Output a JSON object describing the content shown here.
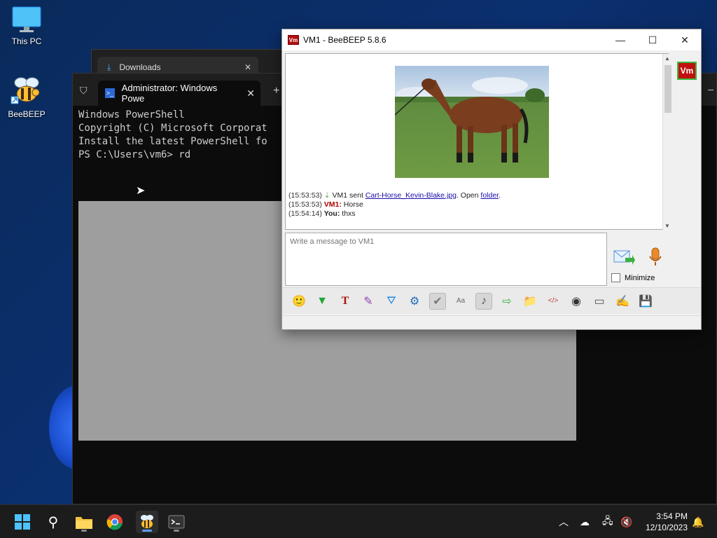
{
  "desktop": {
    "icons": [
      {
        "label": "This PC",
        "icon": "monitor-icon"
      },
      {
        "label": "BeeBEEP",
        "icon": "bee-icon"
      }
    ]
  },
  "downloads_window": {
    "tab_label": "Downloads"
  },
  "powershell": {
    "tab_title": "Administrator: Windows Powe",
    "lines": [
      "Windows PowerShell",
      "Copyright (C) Microsoft Corporat",
      "",
      "Install the latest PowerShell fo",
      "",
      "PS C:\\Users\\vm6> rd"
    ]
  },
  "beebeep": {
    "title": "VM1 - BeeBEEP 5.8.6",
    "app_icon_text": "Vm",
    "side_badge": "Vm",
    "messages": [
      {
        "time": "(15:53:53)",
        "prefix": "VM1 sent ",
        "link": "Cart-Horse_Kevin-Blake.jpg",
        "mid": ". Open ",
        "link2": "folder",
        "suffix": "."
      },
      {
        "time": "(15:53:53)",
        "sender": "VM1:",
        "text": " Horse"
      },
      {
        "time": "(15:54:14)",
        "sender": "You:",
        "text": " thxs"
      }
    ],
    "input_placeholder": "Write a message to VM1",
    "minimize_label": "Minimize",
    "colors": {
      "vm_red": "#b00000",
      "link_blue": "#1a0dab",
      "badge_border": "#3bb83b"
    }
  },
  "taskbar": {
    "time": "3:54 PM",
    "date": "12/10/2023"
  }
}
